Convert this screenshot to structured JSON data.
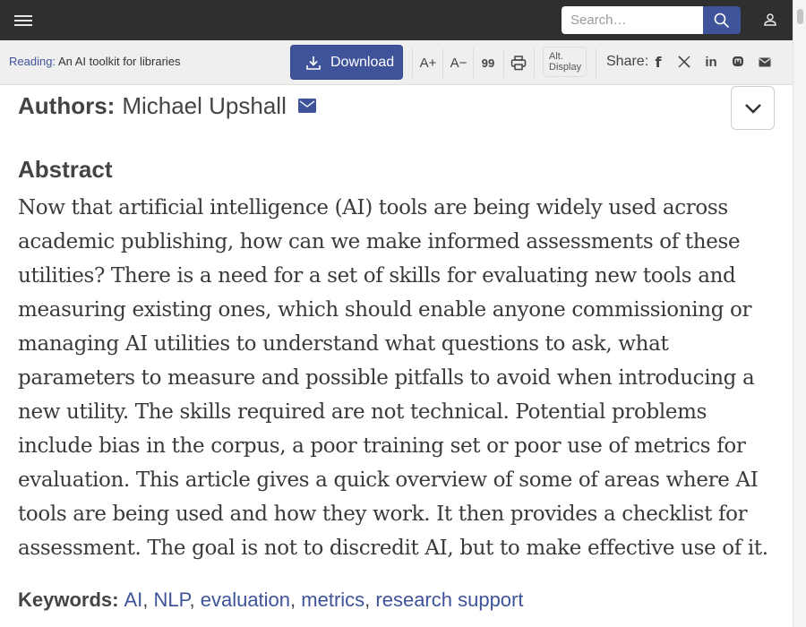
{
  "header": {
    "search_placeholder": "Search…"
  },
  "toolbar": {
    "reading_label": "Reading:",
    "reading_title": "An AI toolkit for libraries",
    "download_label": "Download",
    "font_increase": "A+",
    "font_decrease": "A−",
    "cite": "99",
    "alt_display_line1": "Alt.",
    "alt_display_line2": "Display",
    "share_label": "Share:"
  },
  "article": {
    "authors_label": "Authors:",
    "author_name": "Michael Upshall",
    "abstract_heading": "Abstract",
    "abstract_text": "Now that artificial intelligence (AI) tools are being widely used across academic publishing, how can we make informed assessments of these utilities? There is a need for a set of skills for evaluating new tools and measuring existing ones, which should enable anyone commissioning or managing AI utilities to understand what questions to ask, what parameters to measure and possible pitfalls to avoid when introducing a new utility. The skills required are not technical. Potential problems include bias in the corpus, a poor training set or poor use of metrics for evaluation. This article gives a quick overview of some of areas where AI tools are being used and how they work. It then provides a checklist for assessment. The goal is not to discredit AI, but to make effective use of it.",
    "keywords_label": "Keywords:",
    "keywords": [
      "AI",
      "NLP",
      "evaluation",
      "metrics",
      "research support"
    ]
  },
  "colors": {
    "brand": "#3f539a",
    "topbar": "#2f2f2f",
    "toolbar": "#efefef"
  }
}
